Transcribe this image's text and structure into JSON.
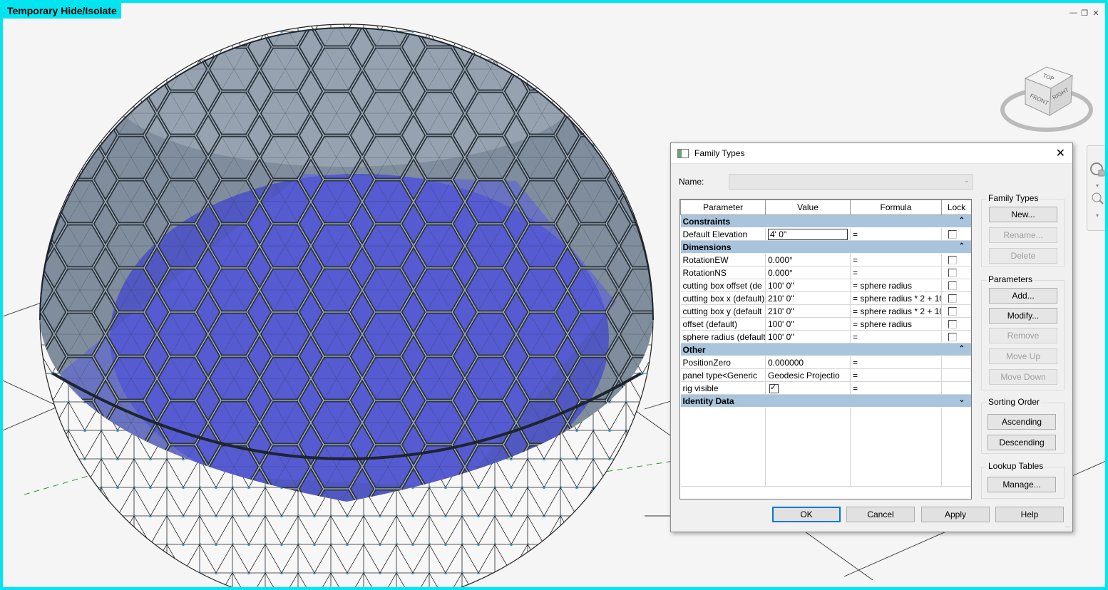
{
  "view": {
    "mode_label": "Temporary Hide/Isolate",
    "window_controls": [
      "minimize-icon",
      "restore-icon",
      "close-icon"
    ],
    "viewcube": {
      "top": "TOP",
      "front": "FRONT",
      "right": "RIGHT"
    },
    "highlight_color": "#00e5f0"
  },
  "dialog": {
    "title": "Family Types",
    "name_label": "Name:",
    "name_value": "",
    "columns": [
      "Parameter",
      "Value",
      "Formula",
      "Lock"
    ],
    "groups": [
      {
        "name": "Constraints",
        "rows": [
          {
            "param": "Default Elevation",
            "value": "4'  0\"",
            "formula": "=",
            "lock": "unchecked"
          }
        ]
      },
      {
        "name": "Dimensions",
        "rows": [
          {
            "param": "RotationEW",
            "value": "0.000°",
            "formula": "=",
            "lock": "unchecked"
          },
          {
            "param": "RotationNS",
            "value": "0.000°",
            "formula": "=",
            "lock": "unchecked"
          },
          {
            "param": "cutting box offset (de",
            "value": "100'  0\"",
            "formula": "= sphere radius",
            "lock": "unchecked"
          },
          {
            "param": "cutting box x (default)",
            "value": "210'  0\"",
            "formula": "= sphere radius * 2 + 10'",
            "lock": "unchecked"
          },
          {
            "param": "cutting box y (default",
            "value": "210'  0\"",
            "formula": "= sphere radius * 2 + 10'",
            "lock": "unchecked"
          },
          {
            "param": "offset (default)",
            "value": "100'  0\"",
            "formula": "= sphere radius",
            "lock": "unchecked"
          },
          {
            "param": "sphere radius (default",
            "value": "100'  0\"",
            "formula": "=",
            "lock": "unchecked"
          }
        ]
      },
      {
        "name": "Other",
        "rows": [
          {
            "param": "PositionZero",
            "value": "0.000000",
            "formula": "=",
            "lock": "none"
          },
          {
            "param": "panel type<Generic",
            "value": "Geodesic Projectio",
            "formula": "=",
            "lock": "none"
          },
          {
            "param": "rig visible",
            "value": "",
            "value_checkbox": true,
            "formula": "=",
            "lock": "none"
          }
        ]
      },
      {
        "name": "Identity Data",
        "rows": []
      }
    ],
    "family_types": {
      "title": "Family Types",
      "new": "New...",
      "rename": "Rename...",
      "delete": "Delete"
    },
    "parameters": {
      "title": "Parameters",
      "add": "Add...",
      "modify": "Modify...",
      "remove": "Remove",
      "move_up": "Move Up",
      "move_down": "Move Down"
    },
    "sorting": {
      "title": "Sorting Order",
      "ascending": "Ascending",
      "descending": "Descending"
    },
    "lookup": {
      "title": "Lookup Tables",
      "manage": "Manage..."
    },
    "footer": {
      "ok": "OK",
      "cancel": "Cancel",
      "apply": "Apply",
      "help": "Help"
    }
  }
}
